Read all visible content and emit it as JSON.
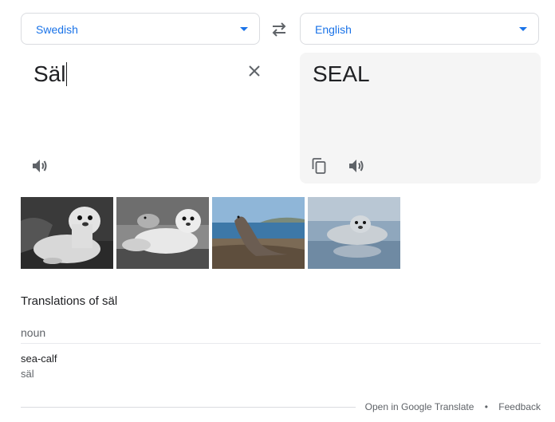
{
  "source_language": {
    "label": "Swedish"
  },
  "target_language": {
    "label": "English"
  },
  "source": {
    "text": "Säl"
  },
  "target": {
    "text": "SEAL"
  },
  "images": [
    {
      "description": "seal-photo-1"
    },
    {
      "description": "seal-photo-2"
    },
    {
      "description": "seal-photo-3"
    },
    {
      "description": "seal-photo-4"
    }
  ],
  "translations": {
    "heading": "Translations of säl",
    "part_of_speech": "noun",
    "entries": [
      {
        "word": "sea-calf",
        "back_translation": "säl"
      }
    ]
  },
  "footer": {
    "open_link": "Open in Google Translate",
    "separator": "•",
    "feedback_link": "Feedback"
  },
  "colors": {
    "accent": "#1a73e8",
    "icon_gray": "#5f6368",
    "target_bg": "#f5f5f5"
  },
  "icons": {
    "swap": "swap-arrows-icon",
    "clear": "close-icon",
    "speaker": "speaker-icon",
    "copy": "copy-icon",
    "dropdown": "caret-down-icon"
  }
}
